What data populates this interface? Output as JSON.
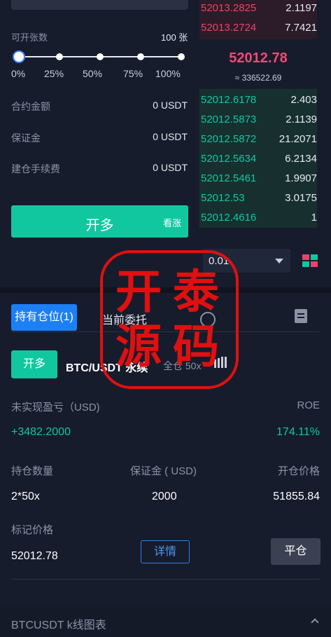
{
  "trade_form": {
    "available_label": "可开张数",
    "available_value": "100 张",
    "slider_levels": [
      "0%",
      "25%",
      "50%",
      "75%",
      "100%"
    ],
    "slider_value_percent": 0,
    "contract_amount_label": "合约金额",
    "contract_amount_value": "0 USDT",
    "margin_label": "保证金",
    "margin_value": "0 USDT",
    "fee_label": "建仓手续费",
    "fee_value": "0 USDT",
    "open_long_label": "开多",
    "open_long_sub": "看涨"
  },
  "order_book": {
    "asks": [
      {
        "price": "52013.2825",
        "qty": "2.1197"
      },
      {
        "price": "52013.2724",
        "qty": "7.7421"
      }
    ],
    "last_price": "52012.78",
    "last_price_sub": "≈ 336522.69",
    "bids": [
      {
        "price": "52012.6178",
        "qty": "2.403"
      },
      {
        "price": "52012.5873",
        "qty": "2.1139"
      },
      {
        "price": "52012.5872",
        "qty": "21.2071"
      },
      {
        "price": "52012.5634",
        "qty": "6.2134"
      },
      {
        "price": "52012.5461",
        "qty": "1.9907"
      },
      {
        "price": "52012.53",
        "qty": "3.0175"
      },
      {
        "price": "52012.4616",
        "qty": "1"
      }
    ],
    "depth_value": "0.01",
    "colors": {
      "ask": "#e6456b",
      "bid": "#10c7a0"
    }
  },
  "tabs": {
    "positions": "持有仓位(1)",
    "orders": "当前委托"
  },
  "position": {
    "side": "开多",
    "symbol": "BTC/USDT 永续",
    "mode": "全仓 50x",
    "pnl_label": "未实现盈亏（USD)",
    "pnl_value": "+3482.2000",
    "roe_label": "ROE",
    "roe_value": "174.11%",
    "qty_label": "持仓数量",
    "qty_value": "2*50x",
    "margin_label": "保证金 ( USD)",
    "margin_value": "2000",
    "entry_label": "开仓价格",
    "entry_value": "51855.84",
    "mark_label": "标记价格",
    "mark_value": "52012.78",
    "detail_button": "详情",
    "close_button": "平仓"
  },
  "kline": {
    "label": "BTCUSDT  k线图表"
  },
  "stamp": {
    "chars": [
      "开",
      "泰",
      "源",
      "码"
    ]
  }
}
